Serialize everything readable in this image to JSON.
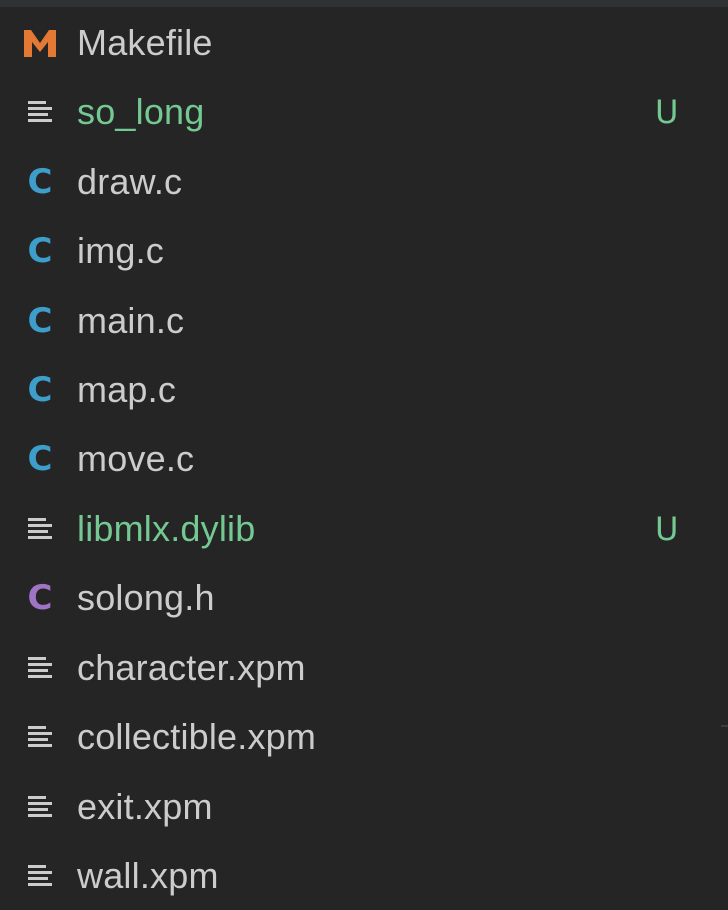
{
  "colors": {
    "background": "#252526",
    "text": "#cccccc",
    "untracked": "#73c991",
    "c_source": "#3e9ecb",
    "c_header": "#a074c4",
    "makefile": "#e37933",
    "lines_icon": "#cccccc"
  },
  "files": [
    {
      "name": "Makefile",
      "icon": "makefile-icon",
      "status": ""
    },
    {
      "name": "so_long",
      "icon": "lines-icon",
      "status": "U"
    },
    {
      "name": "draw.c",
      "icon": "c-file-icon",
      "status": ""
    },
    {
      "name": "img.c",
      "icon": "c-file-icon",
      "status": ""
    },
    {
      "name": "main.c",
      "icon": "c-file-icon",
      "status": ""
    },
    {
      "name": "map.c",
      "icon": "c-file-icon",
      "status": ""
    },
    {
      "name": "move.c",
      "icon": "c-file-icon",
      "status": ""
    },
    {
      "name": "libmlx.dylib",
      "icon": "lines-icon",
      "status": "U"
    },
    {
      "name": "solong.h",
      "icon": "header-file-icon",
      "status": ""
    },
    {
      "name": "character.xpm",
      "icon": "lines-icon",
      "status": ""
    },
    {
      "name": "collectible.xpm",
      "icon": "lines-icon",
      "status": ""
    },
    {
      "name": "exit.xpm",
      "icon": "lines-icon",
      "status": ""
    },
    {
      "name": "wall.xpm",
      "icon": "lines-icon",
      "status": ""
    }
  ]
}
